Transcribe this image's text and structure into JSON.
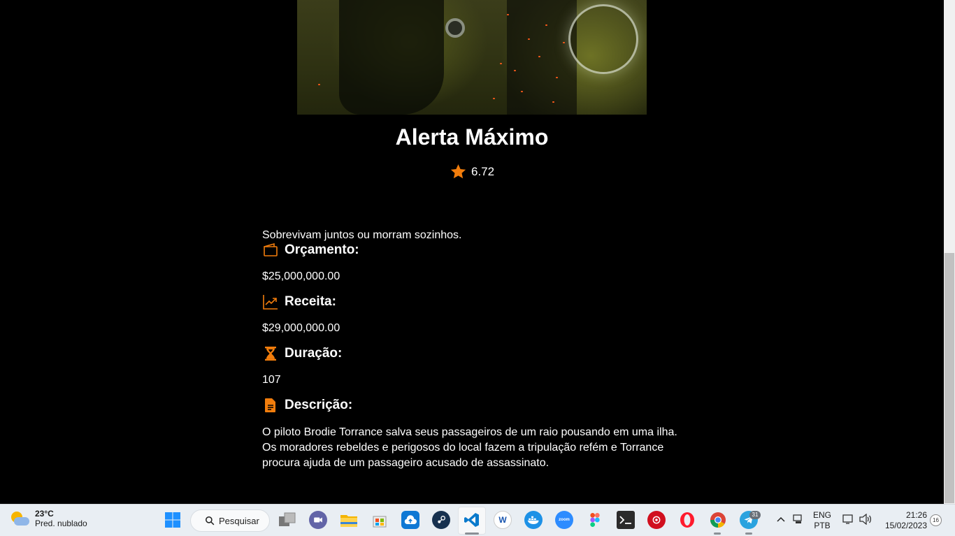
{
  "movie": {
    "title": "Alerta Máximo",
    "rating": "6.72",
    "tagline": "Sobrevivam juntos ou morram sozinhos.",
    "budget_label": "Orçamento:",
    "budget": "$25,000,000.00",
    "revenue_label": "Receita:",
    "revenue": "$29,000,000.00",
    "runtime_label": "Duração:",
    "runtime": "107",
    "description_label": "Descrição:",
    "description": "O piloto Brodie Torrance salva seus passageiros de um raio pousando em uma ilha. Os moradores rebeldes e perigosos do local fazem a tripulação refém e Torrance procura ajuda de um passageiro acusado de assassinato.",
    "accent_color": "#f27d0c"
  },
  "taskbar": {
    "weather_temp": "23°C",
    "weather_condition": "Pred. nublado",
    "search_label": "Pesquisar",
    "telegram_badge": "31",
    "lang_top": "ENG",
    "lang_bottom": "PTB",
    "time": "21:26",
    "date": "15/02/2023",
    "notification_count": "16",
    "apps": [
      "windows-start-icon",
      "task-view-icon",
      "teams-chat-icon",
      "file-explorer-icon",
      "microsoft-store-icon",
      "cloud-upload-icon",
      "steam-icon",
      "vscode-icon",
      "word-app-icon",
      "docker-icon",
      "zoom-icon",
      "figma-icon",
      "terminal-icon",
      "game-app-icon",
      "opera-icon",
      "chrome-icon",
      "telegram-icon"
    ]
  }
}
